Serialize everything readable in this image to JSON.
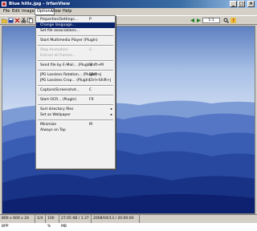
{
  "window": {
    "title": "Blue hills.jpg - IrfanView",
    "minimize_glyph": "_",
    "maximize_glyph": "□",
    "close_glyph": "×"
  },
  "menubar": {
    "items": [
      "File",
      "Edit",
      "Image",
      "Options",
      "View",
      "Help"
    ]
  },
  "toolbar": {
    "zoom_value": "1:1"
  },
  "options_menu": {
    "items": [
      {
        "label": "Properties/Settings...",
        "shortcut": "P",
        "state": "normal"
      },
      {
        "label": "Change language...",
        "shortcut": "",
        "state": "highlighted"
      },
      {
        "label": "Set file associations...",
        "shortcut": "",
        "state": "normal"
      },
      {
        "label": "Start Multimedia Player (PlugIn)",
        "shortcut": "",
        "state": "normal"
      },
      {
        "label": "Stop Animation",
        "shortcut": "G",
        "state": "disabled"
      },
      {
        "label": "Extract all frames...",
        "shortcut": "",
        "state": "disabled"
      },
      {
        "label": "Send file by E-Mail... (PlugIn)",
        "shortcut": "Shift+M",
        "state": "normal"
      },
      {
        "label": "JPG Lossless Rotation... (PlugIn)",
        "shortcut": "Shift+J",
        "state": "normal"
      },
      {
        "label": "JPG Lossless Crop... (PlugIn)",
        "shortcut": "Ctrl+Shift+J",
        "state": "normal"
      },
      {
        "label": "Capture/Screenshot...",
        "shortcut": "C",
        "state": "normal"
      },
      {
        "label": "Start OCR... (PlugIn)",
        "shortcut": "F9",
        "state": "normal"
      },
      {
        "label": "Sort directory files",
        "shortcut": "",
        "state": "submenu"
      },
      {
        "label": "Set as Wallpaper",
        "shortcut": "",
        "state": "submenu"
      },
      {
        "label": "Minimize",
        "shortcut": "M",
        "state": "normal"
      },
      {
        "label": "Always on Top",
        "shortcut": "",
        "state": "normal"
      }
    ]
  },
  "statusbar": {
    "fields": [
      "800 x 600 x 24 BPP",
      "1/4",
      "100 %",
      "27.05 KB / 1.37 MB",
      "2008/04/13 / 20:00:00"
    ]
  },
  "icons": [
    "app-icon",
    "open-folder-icon",
    "save-icon",
    "delete-icon",
    "cut-icon",
    "previous-icon",
    "next-icon",
    "zoom-icon",
    "help-icon",
    "minimize-icon",
    "maximize-icon",
    "close-icon",
    "submenu-arrow-icon"
  ]
}
